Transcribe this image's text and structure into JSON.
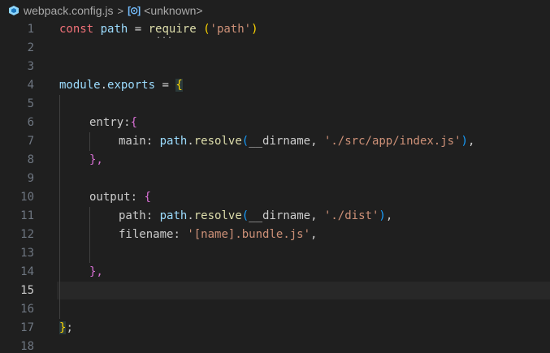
{
  "breadcrumb": {
    "file_name": "webpack.config.js",
    "separator": ">",
    "symbol_icon": "[⊙]",
    "symbol_name": "<unknown>",
    "file_icon": "webpack-cube-icon"
  },
  "editor": {
    "active_line": 15,
    "line_numbers": [
      "1",
      "2",
      "3",
      "4",
      "5",
      "6",
      "7",
      "8",
      "9",
      "10",
      "11",
      "12",
      "13",
      "14",
      "15",
      "16",
      "17",
      "18"
    ],
    "lines": {
      "l1": {
        "const": "const",
        "path": "path",
        "eq": "=",
        "require": "require",
        "lp": "(",
        "str": "'path'",
        "rp": ")"
      },
      "l4": {
        "module": "module",
        "dot": ".",
        "exports": "exports",
        "eq": "=",
        "brace": "{"
      },
      "l6": {
        "entry": "entry",
        "colon": ":",
        "brace": "{"
      },
      "l7": {
        "main": "main",
        "colon": ":",
        "path": "path",
        "dot": ".",
        "resolve": "resolve",
        "lp": "(",
        "dirname": "__dirname",
        "comma": ",",
        "str": "'./src/app/index.js'",
        "rp": ")",
        "trail": ","
      },
      "l8": {
        "text": "},"
      },
      "l10": {
        "output": "output",
        "colon": ":",
        "brace": "{"
      },
      "l11": {
        "key": "path",
        "colon": ":",
        "path": "path",
        "dot": ".",
        "resolve": "resolve",
        "lp": "(",
        "dirname": "__dirname",
        "comma": ",",
        "str": "'./dist'",
        "rp": ")",
        "trail": ","
      },
      "l12": {
        "key": "filename",
        "colon": ":",
        "str": "'[name].bundle.js'",
        "trail": ","
      },
      "l14": {
        "text": "},"
      },
      "l17": {
        "brace": "}",
        "semi": ";"
      }
    },
    "hover_dots": "..."
  },
  "colors": {
    "background": "#1f1f1f",
    "keyword": "#f07178",
    "variable": "#9cdcfe",
    "function": "#dcdcaa",
    "string": "#ce9178",
    "bracket_gold": "#ffd700",
    "bracket_purple": "#da70d6",
    "bracket_blue": "#179fff"
  }
}
